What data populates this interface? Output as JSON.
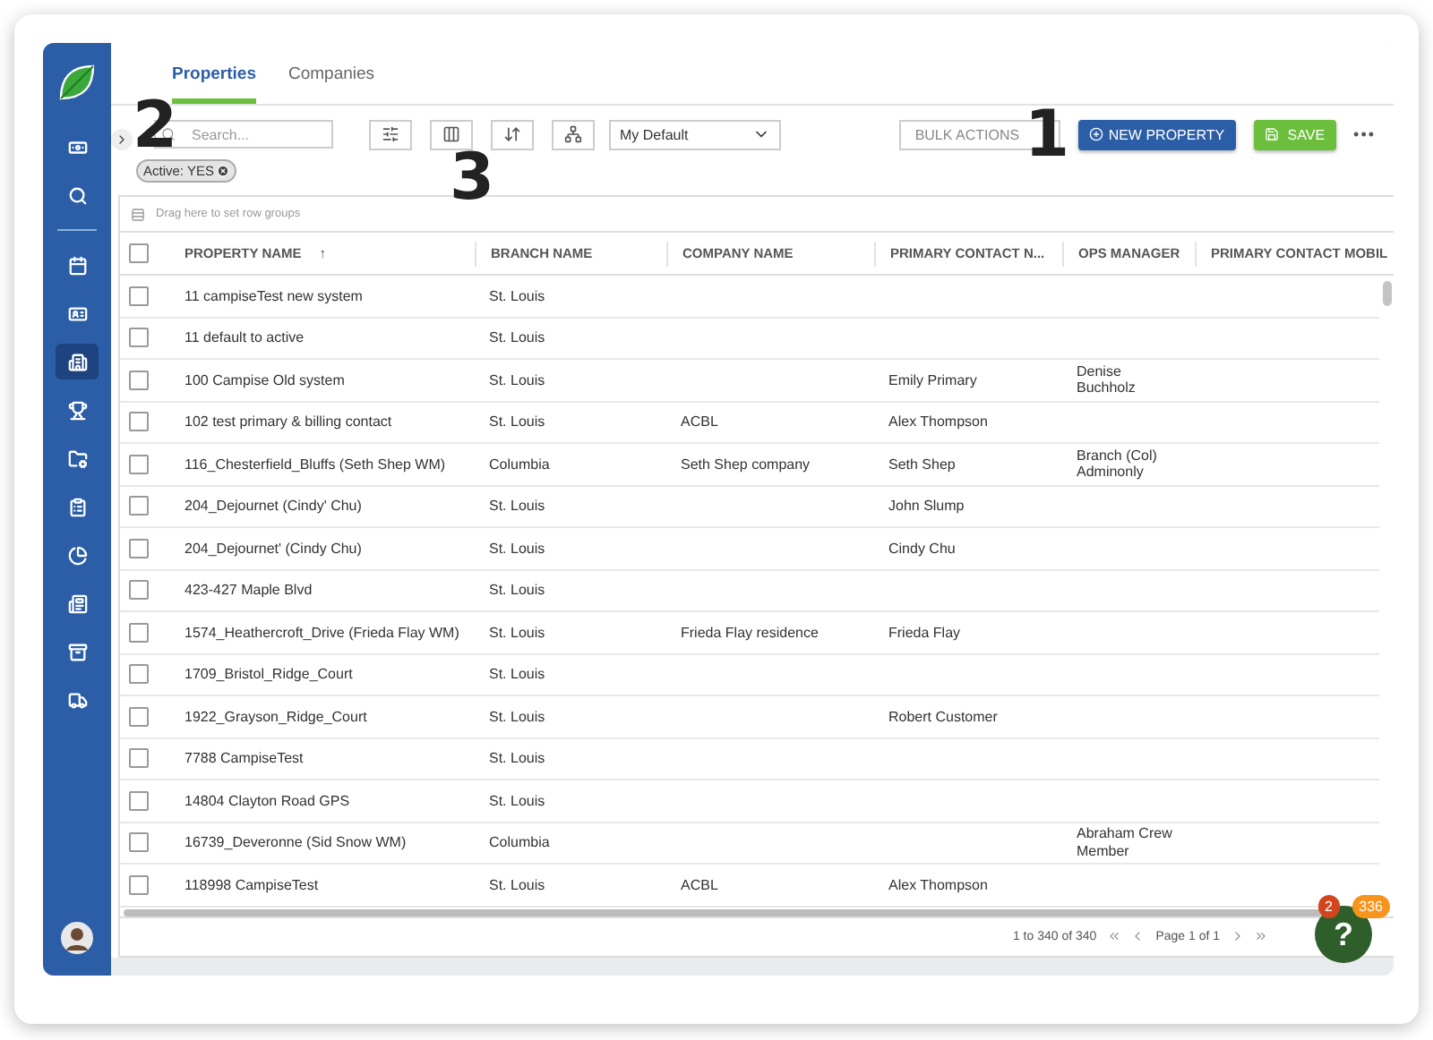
{
  "sidebar": {
    "items": [
      {
        "kind": "money",
        "selected": false
      },
      {
        "kind": "search",
        "selected": false
      },
      {
        "kind": "calendar",
        "selected": false
      },
      {
        "kind": "contact",
        "selected": false
      },
      {
        "kind": "building",
        "selected": true
      },
      {
        "kind": "trophy",
        "selected": false
      },
      {
        "kind": "folder",
        "selected": false
      },
      {
        "kind": "clipboard",
        "selected": false
      },
      {
        "kind": "pie",
        "selected": false
      },
      {
        "kind": "report",
        "selected": false
      },
      {
        "kind": "archive",
        "selected": false
      },
      {
        "kind": "truck",
        "selected": false
      }
    ]
  },
  "tabs": [
    {
      "label": "Properties",
      "selected": true
    },
    {
      "label": "Companies",
      "selected": false
    }
  ],
  "toolbar": {
    "search": {
      "placeholder": "Search..."
    },
    "view_select": {
      "value": "My Default"
    },
    "bulk_actions": "BULK ACTIONS",
    "new_property": "NEW PROPERTY",
    "save": "SAVE",
    "more": "•••"
  },
  "filter_chip": {
    "label": "Active: YES"
  },
  "group_bar": {
    "placeholder": "Drag here to set row groups"
  },
  "table": {
    "select_all_checked": false,
    "columns": [
      {
        "label": "PROPERTY NAME",
        "sort": "↑"
      },
      {
        "label": "BRANCH NAME"
      },
      {
        "label": "COMPANY NAME"
      },
      {
        "label": "PRIMARY CONTACT N..."
      },
      {
        "label": "OPS MANAGER"
      },
      {
        "label": "PRIMARY CONTACT MOBIL"
      }
    ],
    "rows": [
      {
        "checked": false,
        "cells": [
          "11 campiseTest new system",
          "St. Louis",
          "",
          "",
          "",
          ""
        ]
      },
      {
        "checked": false,
        "cells": [
          "11 default to active",
          "St. Louis",
          "",
          "",
          "",
          ""
        ]
      },
      {
        "checked": false,
        "cells": [
          "100 Campise Old system",
          "St. Louis",
          "",
          "Emily Primary",
          "Denise\nBuchholz",
          ""
        ]
      },
      {
        "checked": false,
        "cells": [
          "102 test primary & billing contact",
          "St. Louis",
          "ACBL",
          "Alex Thompson",
          "",
          ""
        ]
      },
      {
        "checked": false,
        "cells": [
          "116_Chesterfield_Bluffs (Seth Shep WM)",
          "Columbia",
          "Seth Shep company",
          "Seth Shep",
          "Branch (Col)\nAdminonly",
          ""
        ]
      },
      {
        "checked": false,
        "cells": [
          "204_Dejournet (Cindy' Chu)",
          "St. Louis",
          "",
          "John Slump",
          "",
          ""
        ]
      },
      {
        "checked": false,
        "cells": [
          "204_Dejournet' (Cindy Chu)",
          "St. Louis",
          "",
          "Cindy Chu",
          "",
          ""
        ]
      },
      {
        "checked": false,
        "cells": [
          "423-427 Maple Blvd",
          "St. Louis",
          "",
          "",
          "",
          ""
        ]
      },
      {
        "checked": false,
        "cells": [
          "1574_Heathercroft_Drive (Frieda Flay WM)",
          "St. Louis",
          "Frieda Flay residence",
          "Frieda Flay",
          "",
          ""
        ]
      },
      {
        "checked": false,
        "cells": [
          "1709_Bristol_Ridge_Court",
          "St. Louis",
          "",
          "",
          "",
          ""
        ]
      },
      {
        "checked": false,
        "cells": [
          "1922_Grayson_Ridge_Court",
          "St. Louis",
          "",
          "Robert Customer",
          "",
          ""
        ]
      },
      {
        "checked": false,
        "cells": [
          "7788 CampiseTest",
          "St. Louis",
          "",
          "",
          "",
          ""
        ]
      },
      {
        "checked": false,
        "cells": [
          "14804 Clayton Road GPS",
          "St. Louis",
          "",
          "",
          "",
          ""
        ]
      },
      {
        "checked": false,
        "cells": [
          "16739_Deveronne (Sid Snow WM)",
          "Columbia",
          "",
          "",
          "Abraham Crew\nMember",
          ""
        ]
      },
      {
        "checked": false,
        "cells": [
          "118998 CampiseTest",
          "St. Louis",
          "ACBL",
          "Alex Thompson",
          "",
          ""
        ]
      }
    ]
  },
  "pagination": {
    "summary": "1 to 340 of 340",
    "page": "Page 1 of 1"
  },
  "help": {
    "badge_red": "2",
    "badge_orange": "336",
    "glyph": "?"
  },
  "callouts": [
    {
      "label": "1"
    },
    {
      "label": "2"
    },
    {
      "label": "3"
    }
  ]
}
